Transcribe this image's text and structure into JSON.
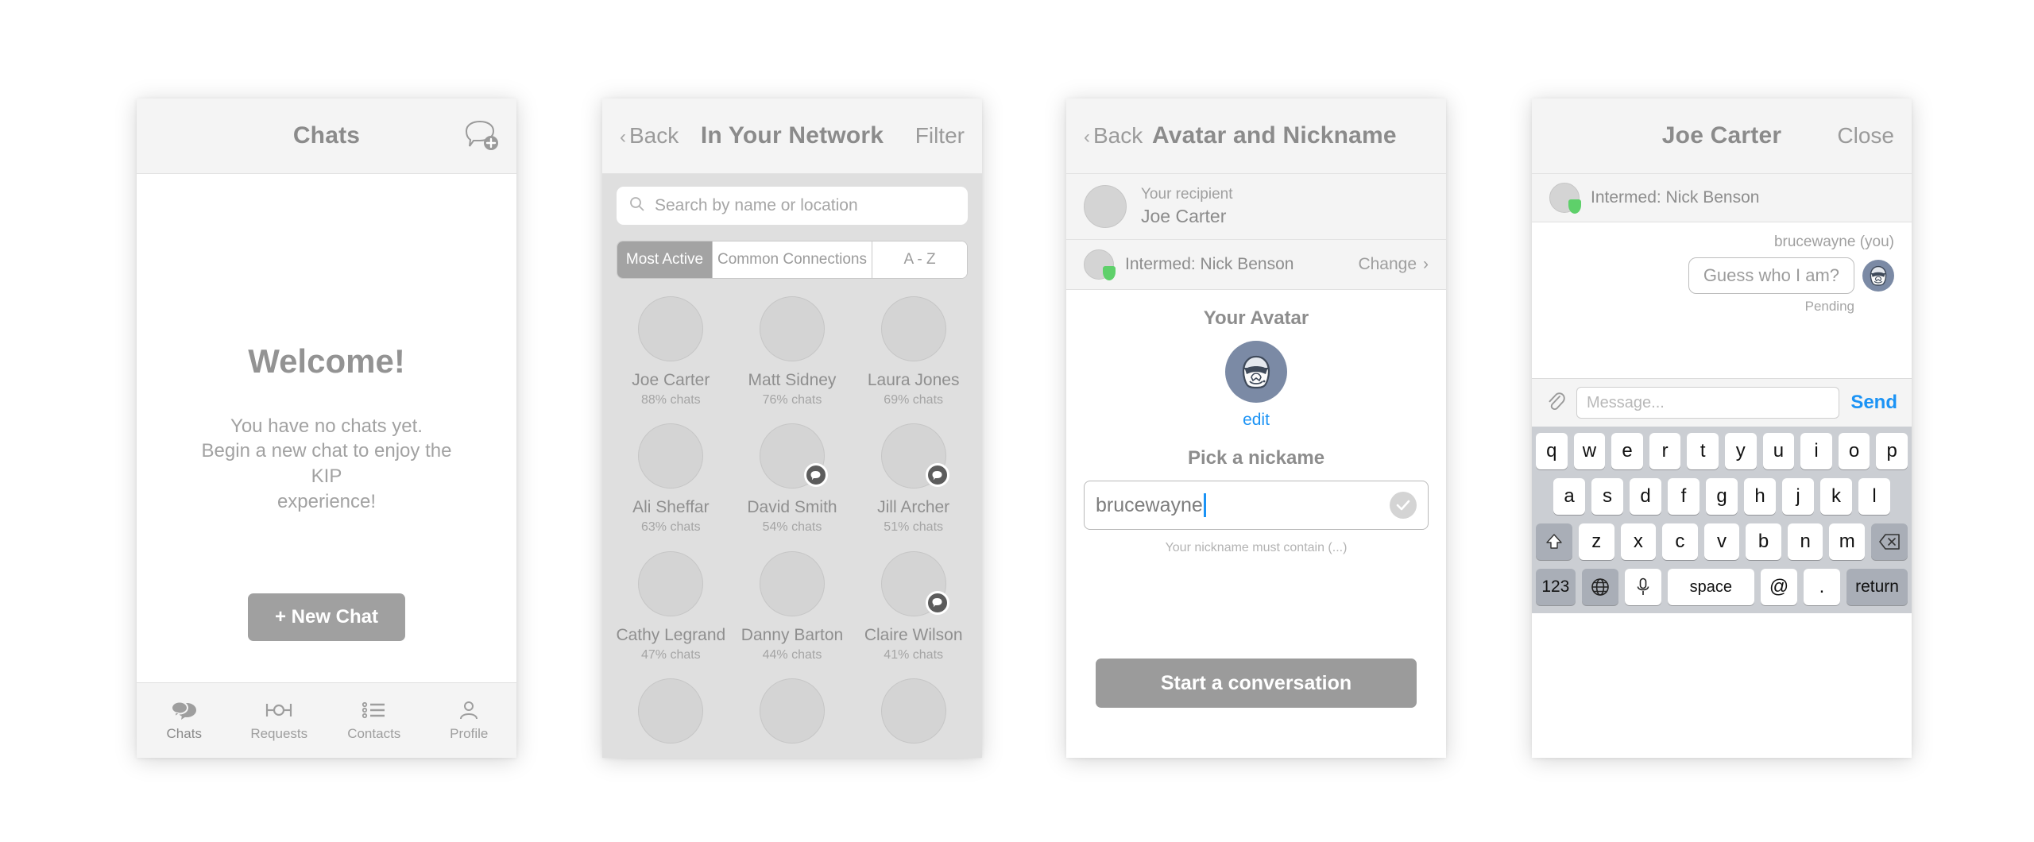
{
  "colors": {
    "accent_blue": "#1b93f5",
    "gray_button": "#a0a0a0",
    "navbar_bg": "#f4f4f4",
    "grid_bg": "#dfdfdf",
    "avatar_blue": "#7b8aa5",
    "badge_green": "#5ed06a",
    "keyboard_bg": "#cbced3"
  },
  "phone1": {
    "navbar": {
      "title": "Chats",
      "compose_icon": "new-chat-bubble-icon"
    },
    "welcome": {
      "title": "Welcome!",
      "line1": "You have no chats yet.",
      "line2": "Begin a new chat to enjoy the KIP",
      "line3": "experience!"
    },
    "new_chat_button": "+ New Chat",
    "tabs": [
      {
        "label": "Chats",
        "icon": "chat-bubbles-icon",
        "active": true
      },
      {
        "label": "Requests",
        "icon": "requests-link-icon",
        "active": false
      },
      {
        "label": "Contacts",
        "icon": "list-icon",
        "active": false
      },
      {
        "label": "Profile",
        "icon": "person-icon",
        "active": false
      }
    ]
  },
  "phone2": {
    "navbar": {
      "back": "Back",
      "title": "In Your Network",
      "filter": "Filter"
    },
    "search": {
      "placeholder": "Search by name or location",
      "icon": "search-icon"
    },
    "segments": [
      {
        "label": "Most Active",
        "active": true
      },
      {
        "label": "Common Connections",
        "active": false
      },
      {
        "label": "A - Z",
        "active": false
      }
    ],
    "people": [
      {
        "name": "Joe Carter",
        "stat": "88% chats",
        "badge": false
      },
      {
        "name": "Matt Sidney",
        "stat": "76% chats",
        "badge": false
      },
      {
        "name": "Laura Jones",
        "stat": "69% chats",
        "badge": false
      },
      {
        "name": "Ali Sheffar",
        "stat": "63% chats",
        "badge": false
      },
      {
        "name": "David Smith",
        "stat": "54% chats",
        "badge": true
      },
      {
        "name": "Jill Archer",
        "stat": "51% chats",
        "badge": true
      },
      {
        "name": "Cathy Legrand",
        "stat": "47% chats",
        "badge": false
      },
      {
        "name": "Danny Barton",
        "stat": "44% chats",
        "badge": false
      },
      {
        "name": "Claire Wilson",
        "stat": "41% chats",
        "badge": true
      }
    ]
  },
  "phone3": {
    "navbar": {
      "back": "Back",
      "title": "Avatar and Nickname"
    },
    "recipient": {
      "label": "Your recipient",
      "name": "Joe Carter"
    },
    "intermediary": {
      "text": "Intermed: Nick Benson",
      "change": "Change"
    },
    "avatar_section": {
      "title": "Your Avatar",
      "edit": "edit",
      "avatar_icon": "stormtrooper-avatar-icon"
    },
    "nickname": {
      "title": "Pick a nickame",
      "value": "brucewayne",
      "hint": "Your nickname must contain (...)",
      "valid_icon": "check-icon"
    },
    "start_button": "Start a conversation"
  },
  "phone4": {
    "navbar": {
      "title": "Joe Carter",
      "close": "Close"
    },
    "intermediary": {
      "text": "Intermed: Nick Benson"
    },
    "message": {
      "sender": "brucewayne (you)",
      "text": "Guess who I am?",
      "status": "Pending",
      "avatar_icon": "stormtrooper-avatar-icon"
    },
    "inputbar": {
      "attach_icon": "paperclip-icon",
      "placeholder": "Message...",
      "send": "Send"
    },
    "keyboard": {
      "row1": [
        "q",
        "w",
        "e",
        "r",
        "t",
        "y",
        "u",
        "i",
        "o",
        "p"
      ],
      "row2": [
        "a",
        "s",
        "d",
        "f",
        "g",
        "h",
        "j",
        "k",
        "l"
      ],
      "row3": [
        "z",
        "x",
        "c",
        "v",
        "b",
        "n",
        "m"
      ],
      "shift_icon": "shift-icon",
      "backspace_icon": "backspace-icon",
      "numbers": "123",
      "globe_icon": "globe-icon",
      "mic_icon": "microphone-icon",
      "space": "space",
      "at": "@",
      "period": ".",
      "return": "return"
    }
  }
}
